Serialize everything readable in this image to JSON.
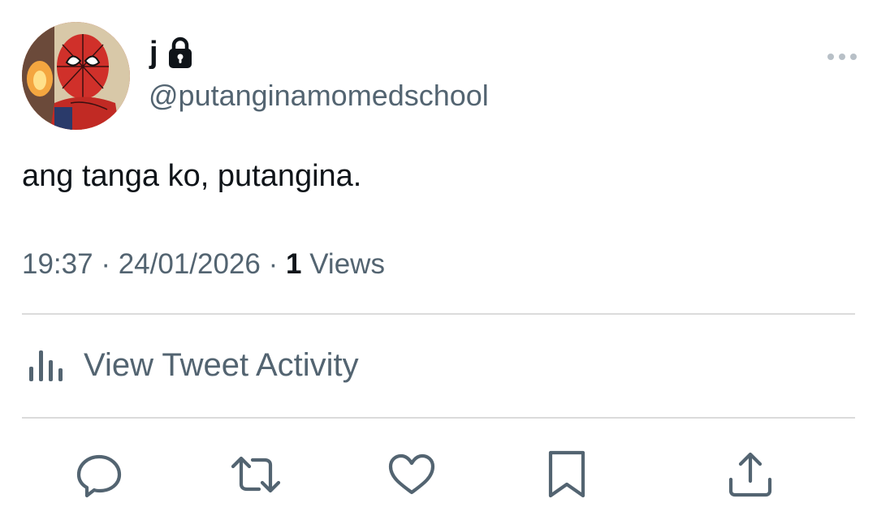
{
  "tweet": {
    "display_name": "j",
    "handle": "@putanginamomedschool",
    "text": "ang tanga ko, putangina.",
    "time": "19:37",
    "separator": "·",
    "date": "24/01/2026",
    "views_count": "1",
    "views_label": "Views"
  },
  "activity": {
    "label": "View Tweet Activity",
    "icon": "bar-chart-icon"
  },
  "actions": [
    {
      "name": "reply",
      "icon": "reply-icon"
    },
    {
      "name": "retweet",
      "icon": "retweet-icon"
    },
    {
      "name": "like",
      "icon": "heart-icon"
    },
    {
      "name": "bookmark",
      "icon": "bookmark-icon"
    },
    {
      "name": "share",
      "icon": "share-icon"
    }
  ],
  "icons": {
    "lock": "lock-icon",
    "more": "more-horizontal-icon",
    "avatar": "spider-man-avatar"
  },
  "colors": {
    "text_primary": "#0f1419",
    "text_secondary": "#536471",
    "divider": "#dbdbdb",
    "background": "#ffffff"
  }
}
